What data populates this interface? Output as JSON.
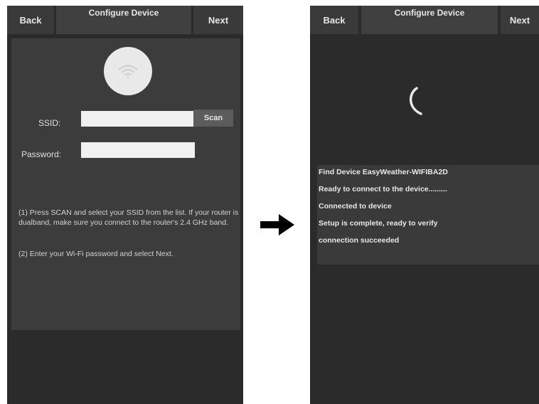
{
  "left_screen": {
    "header": {
      "back_label": "Back",
      "title": "Configure Device",
      "next_label": "Next"
    },
    "form": {
      "ssid_label": "SSID:",
      "ssid_value": "",
      "password_label": "Password:",
      "password_value": "",
      "scan_label": "Scan"
    },
    "instructions": [
      "(1) Press SCAN and select your SSID from the list. If your router is dualband, make sure you connect to the router's 2.4 GHz band.",
      "(2) Enter your Wi-Fi password and select Next."
    ]
  },
  "right_screen": {
    "header": {
      "back_label": "Back",
      "title": "Configure Device",
      "next_label": "Next"
    },
    "log": [
      "Find Device EasyWeather-WIFIBA2D",
      "Ready to connect to the device.........",
      "Connected to device",
      "Setup is complete, ready to verify",
      "connection succeeded"
    ]
  },
  "icons": {
    "wifi": "wifi-icon",
    "spinner": "loading-spinner-icon",
    "arrow": "arrow-right-icon"
  },
  "colors": {
    "screen_bg": "#2b2b2b",
    "card_bg": "#3c3c3c",
    "text": "#e6e6e6",
    "input_bg": "#f0f0f0"
  }
}
